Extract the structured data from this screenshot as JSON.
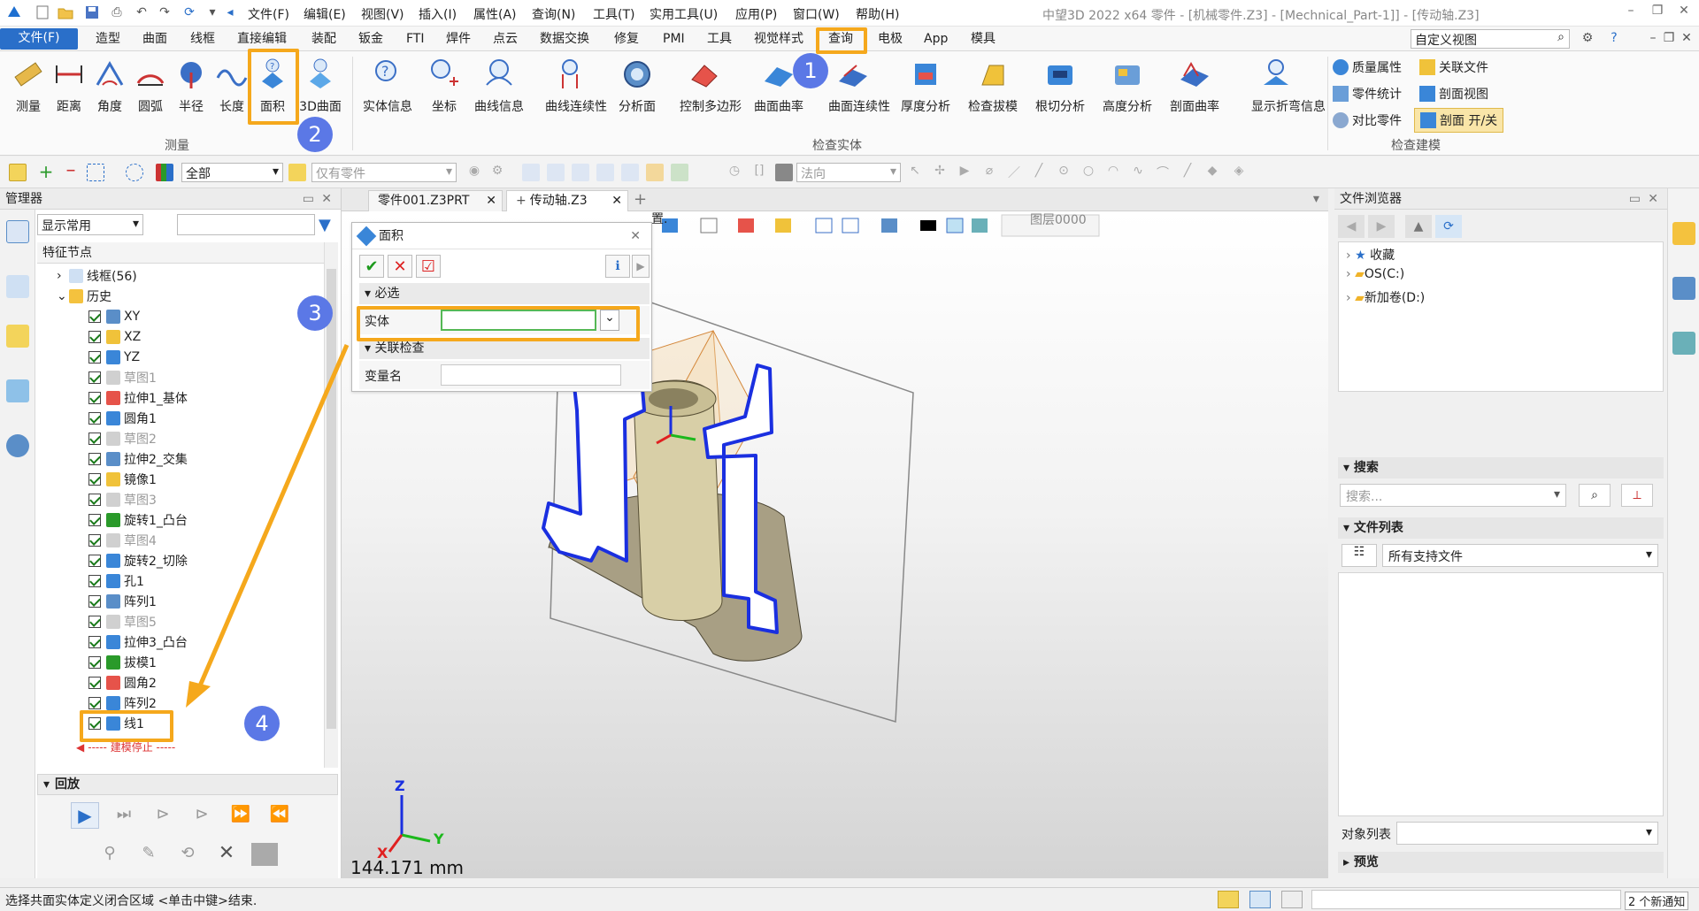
{
  "title_bar": {
    "app_title": "中望3D 2022 x64    零件 - [机械零件.Z3] - [Mechnical_Part-1]] - [传动轴.Z3]",
    "menus": [
      "文件(F)",
      "编辑(E)",
      "视图(V)",
      "插入(I)",
      "属性(A)",
      "查询(N)",
      "工具(T)",
      "实用工具(U)",
      "应用(P)",
      "窗口(W)",
      "帮助(H)"
    ]
  },
  "ribbon_tabs": [
    "文件(F)",
    "造型",
    "曲面",
    "线框",
    "直接编辑",
    "装配",
    "钣金",
    "FTI",
    "焊件",
    "点云",
    "数据交换",
    "修复",
    "PMI",
    "工具",
    "视觉样式",
    "查询",
    "电极",
    "App",
    "模具"
  ],
  "view_select": "自定义视图",
  "ribbon": {
    "measure_group": {
      "label": "测量",
      "buttons": [
        "测量",
        "距离",
        "角度",
        "圆弧",
        "半径",
        "长度",
        "面积",
        "3D曲面"
      ]
    },
    "inspect_group": {
      "label": "检查实体",
      "buttons": [
        "实体信息",
        "坐标",
        "曲线信息",
        "曲线连续性",
        "分析面",
        "控制多边形",
        "曲面曲率",
        "曲面连续性",
        "厚度分析",
        "检查拔模",
        "根切分析",
        "高度分析",
        "剖面曲率",
        "显示折弯信息"
      ]
    },
    "model_group": {
      "label": "检查建模",
      "items": [
        "质量属性",
        "关联文件",
        "零件统计",
        "剖面视图",
        "对比零件",
        "剖面 开/关"
      ]
    }
  },
  "toolbar2": {
    "filter": "全部",
    "scope": "仅有零件",
    "direction": "法向",
    "layer": "图层0000"
  },
  "manager": {
    "title": "管理器",
    "filter": "显示常用",
    "column": "特征节点",
    "nodes": [
      {
        "label": "线框(56)",
        "type": "folder-collapsed"
      },
      {
        "label": "历史",
        "type": "folder-open"
      },
      {
        "label": "XY",
        "checked": true,
        "grey": false
      },
      {
        "label": "XZ",
        "checked": true,
        "grey": false
      },
      {
        "label": "YZ",
        "checked": true,
        "grey": false
      },
      {
        "label": "草图1",
        "checked": true,
        "grey": true
      },
      {
        "label": "拉伸1_基体",
        "checked": true,
        "grey": false
      },
      {
        "label": "圆角1",
        "checked": true,
        "grey": false
      },
      {
        "label": "草图2",
        "checked": true,
        "grey": true
      },
      {
        "label": "拉伸2_交集",
        "checked": true,
        "grey": false
      },
      {
        "label": "镜像1",
        "checked": true,
        "grey": false
      },
      {
        "label": "草图3",
        "checked": true,
        "grey": true
      },
      {
        "label": "旋转1_凸台",
        "checked": true,
        "grey": false
      },
      {
        "label": "草图4",
        "checked": true,
        "grey": true
      },
      {
        "label": "旋转2_切除",
        "checked": true,
        "grey": false
      },
      {
        "label": "孔1",
        "checked": true,
        "grey": false
      },
      {
        "label": "阵列1",
        "checked": true,
        "grey": false
      },
      {
        "label": "草图5",
        "checked": true,
        "grey": true
      },
      {
        "label": "拉伸3_凸台",
        "checked": true,
        "grey": false
      },
      {
        "label": "拔模1",
        "checked": true,
        "grey": false
      },
      {
        "label": "圆角2",
        "checked": true,
        "grey": false
      },
      {
        "label": "阵列2",
        "checked": true,
        "grey": false
      },
      {
        "label": "线1",
        "checked": true,
        "grey": false
      }
    ],
    "stop_marker": "----- 建模停止 -----",
    "playback": "回放"
  },
  "doc_tabs": [
    "零件001.Z3PRT",
    "传动轴.Z3"
  ],
  "dialog": {
    "title": "面积",
    "required_section": "必选",
    "entity_label": "实体",
    "assoc_section": "关联检查",
    "varname_label": "变量名",
    "hint_char": "置."
  },
  "viewport": {
    "distance": "144.171 mm",
    "axes": [
      "X",
      "Y",
      "Z"
    ]
  },
  "file_browser": {
    "title": "文件浏览器",
    "tree": [
      "收藏",
      "OS(C:)",
      "新加卷(D:)"
    ],
    "search_header": "搜索",
    "search_placeholder": "搜索...",
    "file_list_header": "文件列表",
    "file_filter": "所有支持文件",
    "object_list": "对象列表",
    "preview": "预览"
  },
  "status": {
    "message": "选择共面实体定义闭合区域 <单击中键>结束.",
    "notice": "2 个新通知"
  },
  "annotations": {
    "steps": [
      "1",
      "2",
      "3",
      "4"
    ],
    "color": "#f5a81c",
    "badge_color": "#5b78e6"
  }
}
